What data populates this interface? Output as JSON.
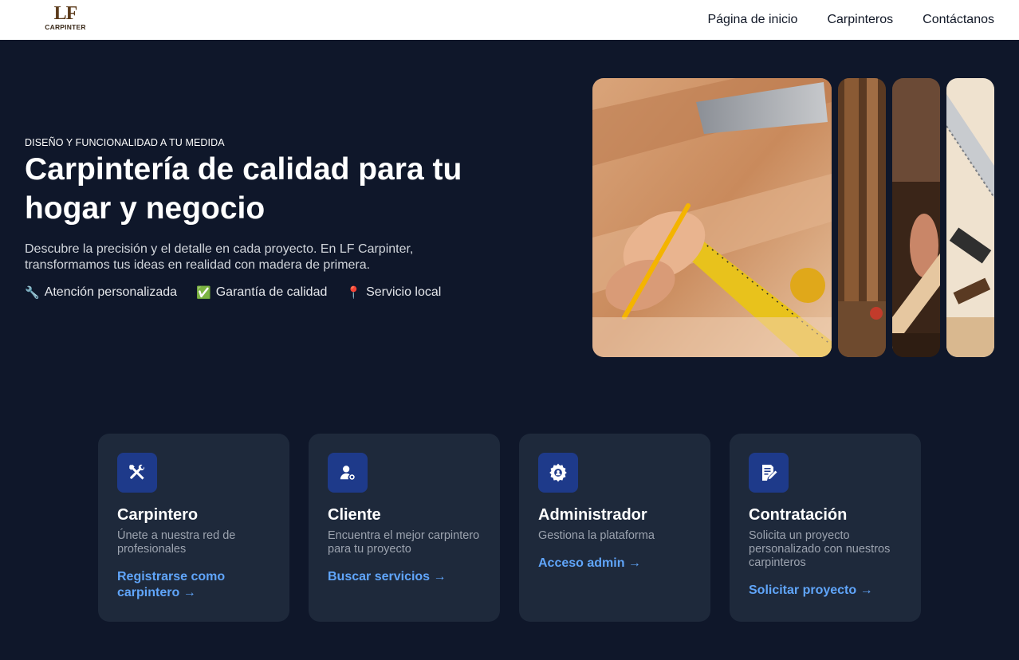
{
  "header": {
    "logo_main": "LF",
    "logo_sub": "CARPINTER",
    "nav": [
      "Página de inicio",
      "Carpinteros",
      "Contáctanos"
    ]
  },
  "hero": {
    "eyebrow": "DISEÑO Y FUNCIONALIDAD A TU MEDIDA",
    "title": "Carpintería de calidad para tu hogar y negocio",
    "description": "Descubre la precisión y el detalle en cada proyecto. En LF Carpinter, transformamos tus ideas en realidad con madera de primera.",
    "features": [
      {
        "icon": "🔧",
        "label": "Atención personalizada"
      },
      {
        "icon": "✅",
        "label": "Garantía de calidad"
      },
      {
        "icon": "📍",
        "label": "Servicio local"
      }
    ]
  },
  "cards": [
    {
      "icon": "hammer-wrench-icon",
      "title": "Carpintero",
      "description": "Únete a nuestra red de profesionales",
      "link": "Registrarse como carpintero →"
    },
    {
      "icon": "user-search-icon",
      "title": "Cliente",
      "description": "Encuentra el mejor carpintero para tu proyecto",
      "link": "Buscar servicios →"
    },
    {
      "icon": "gear-icon",
      "title": "Administrador",
      "description": "Gestiona la plataforma",
      "link": "Acceso admin →"
    },
    {
      "icon": "document-edit-icon",
      "title": "Contratación",
      "description": "Solicita un proyecto personalizado con nuestros carpinteros",
      "link": "Solicitar proyecto →"
    }
  ],
  "colors": {
    "background": "#0f172a",
    "card": "#1e293b",
    "icon_bg": "#1e3a8a",
    "link": "#60a5fa"
  }
}
